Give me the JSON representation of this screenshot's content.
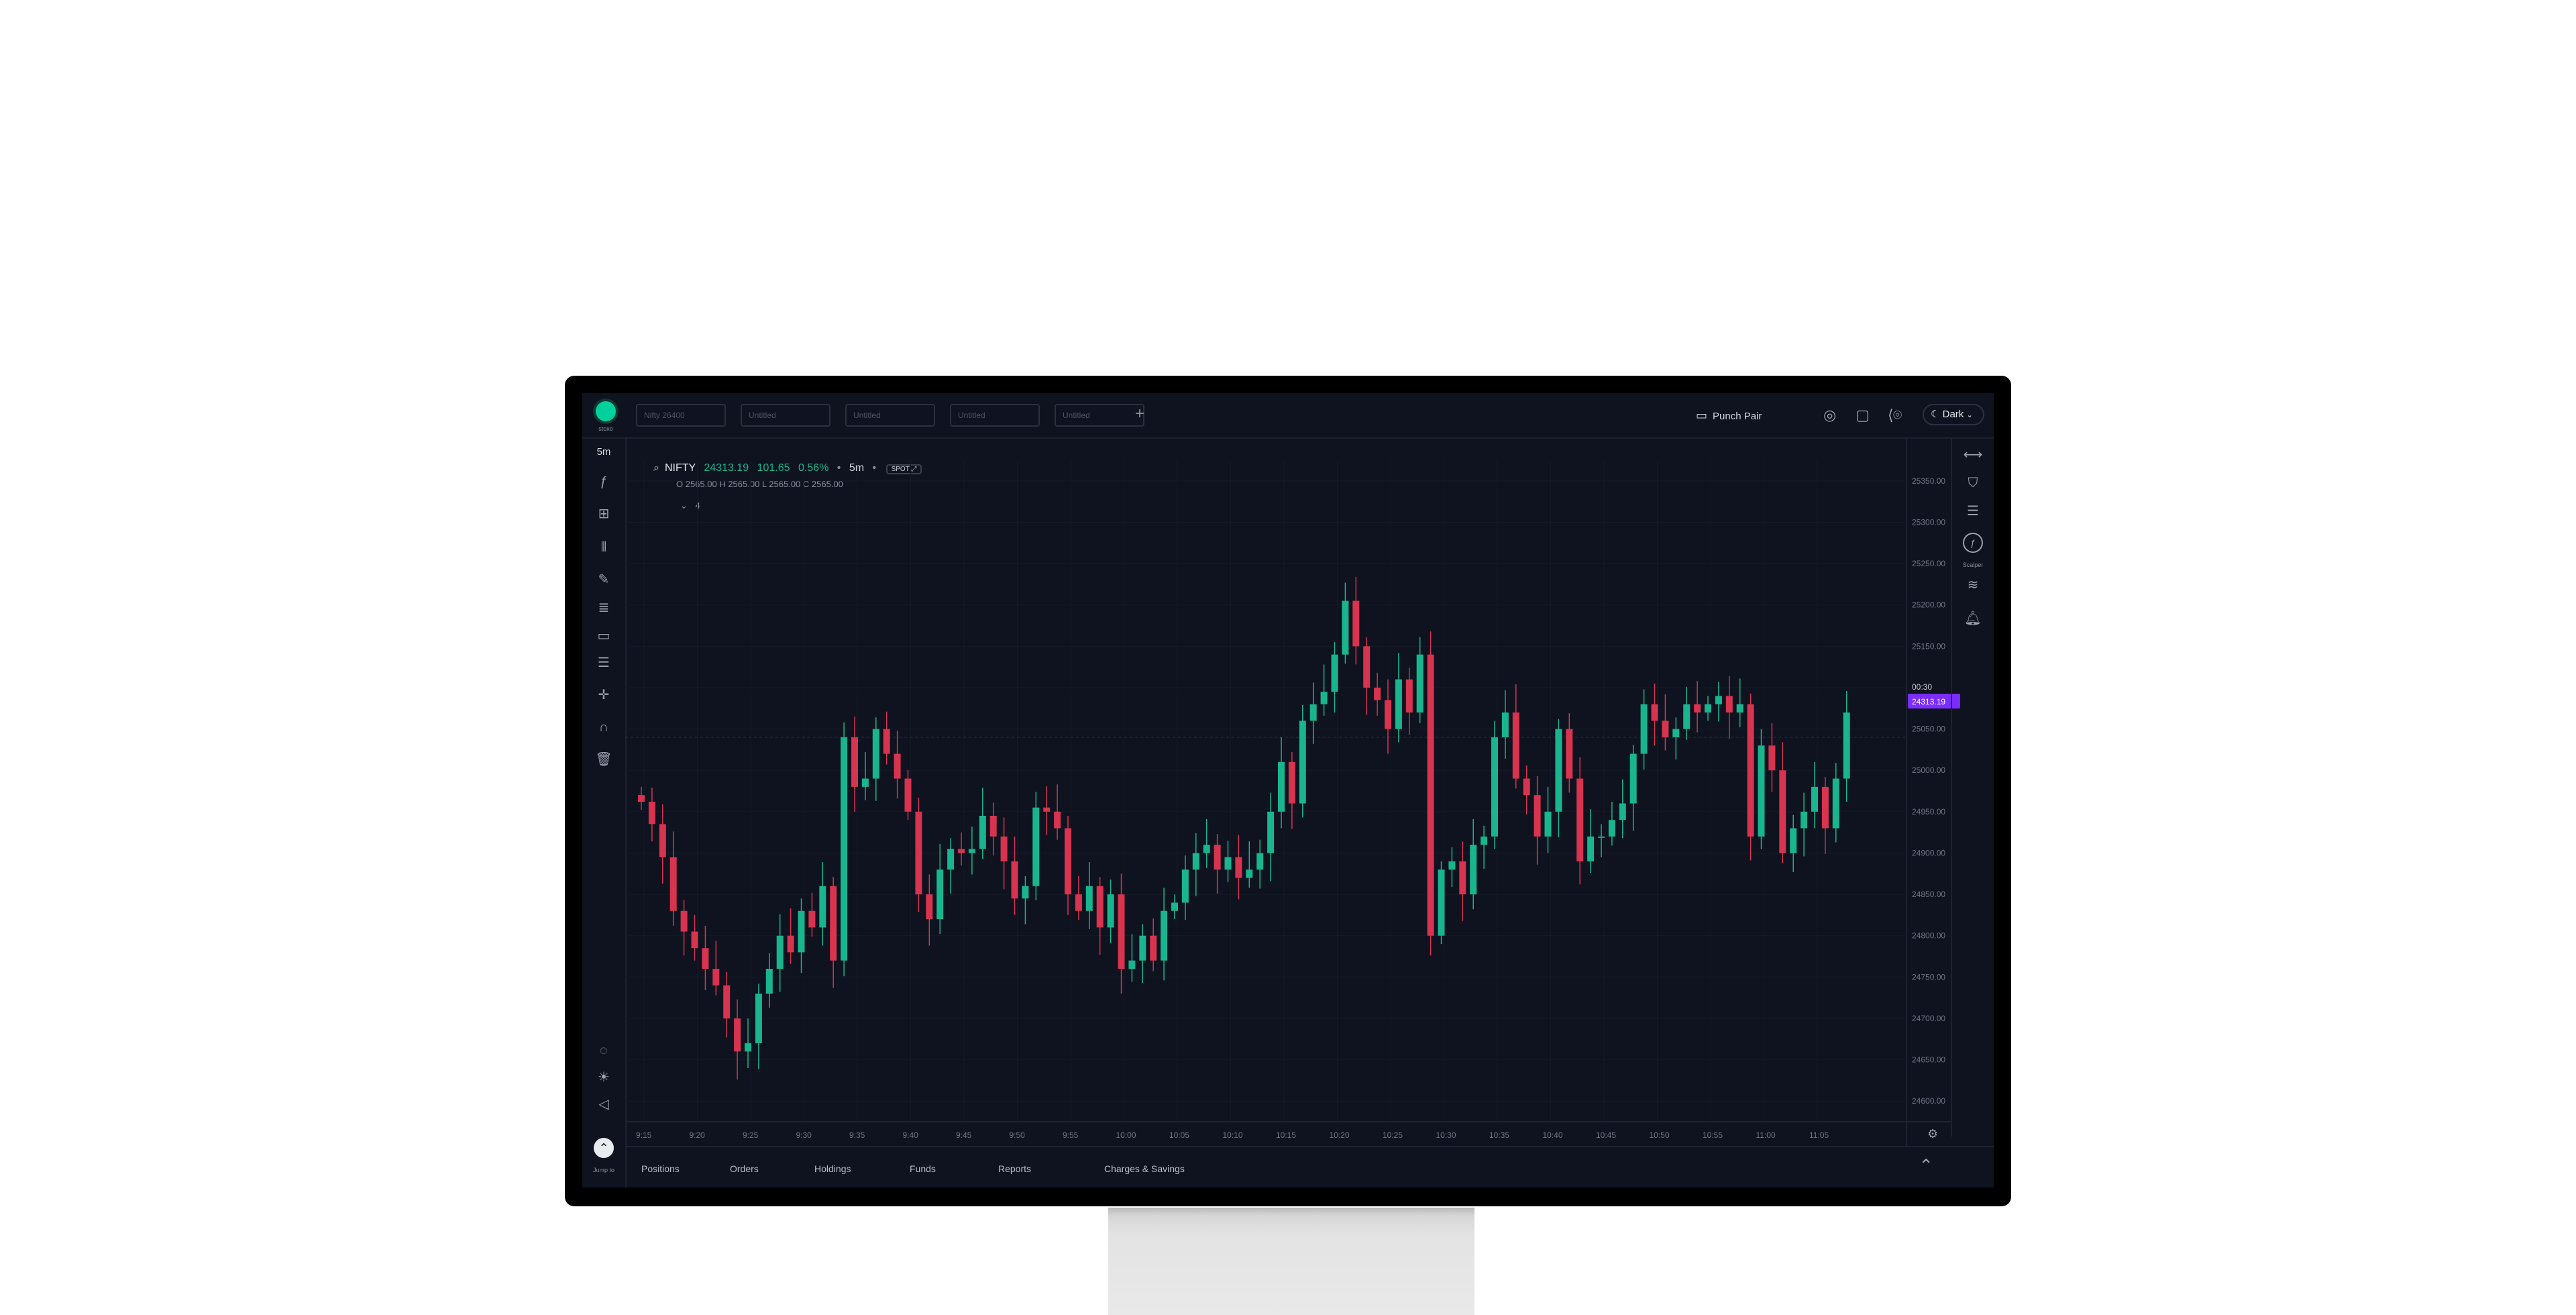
{
  "topbar": {
    "logo_text": "stoxo",
    "chart_tabs": [
      "Nifty 26400",
      "Untitled",
      "Untitled",
      "Untitled",
      "Untitled"
    ],
    "punch_pair_label": "Punch Pair",
    "theme_label": "Dark"
  },
  "leftbar": {
    "interval": "5m",
    "jump_label": "Jump to"
  },
  "legend": {
    "symbol": "NIFTY",
    "price": "24313.19",
    "change": "101.65",
    "change_pct": "0.56%",
    "interval": "5m",
    "spot_label": "SPOT",
    "ohlc": "O 2565.00   H 2565.00   L 2565.00   C 2565.00",
    "indicators_count": "4"
  },
  "rightbar": {
    "scalper_label": "Scalper"
  },
  "bottom_tabs": [
    "Positions",
    "Orders",
    "Holdings",
    "Funds",
    "Reports",
    "Charges & Savings"
  ],
  "colors": {
    "up": "#18b58f",
    "down": "#d8334f",
    "accent": "#00d09c",
    "price_tag": "#7b2cff"
  },
  "chart_data": {
    "type": "candlestick",
    "x_labels": [
      "9:15",
      "9:20",
      "9:25",
      "9:30",
      "9:35",
      "9:40",
      "9:45",
      "9:50",
      "9:55",
      "10:00",
      "10:05",
      "10:10",
      "10:15",
      "10:20",
      "10:25",
      "10:30",
      "10:35",
      "10:40",
      "10:45",
      "10:50",
      "10:55",
      "11:00",
      "11:05"
    ],
    "y_ticks": [
      25350,
      25300,
      25250,
      25200,
      25150,
      25100,
      25050,
      25000,
      24950,
      24900,
      24850,
      24800,
      24750,
      24700,
      24650,
      24600
    ],
    "ylim": [
      24575,
      25375
    ],
    "last_price": "24313.19",
    "countdown": "00:30",
    "closes": [
      24962,
      24935,
      24895,
      24830,
      24805,
      24785,
      24760,
      24740,
      24700,
      24660,
      24670,
      24730,
      24760,
      24800,
      24780,
      24830,
      24810,
      24860,
      24770,
      25040,
      24980,
      24990,
      25050,
      25020,
      24990,
      24950,
      24850,
      24820,
      24880,
      24905,
      24900,
      24905,
      24945,
      24920,
      24890,
      24845,
      24860,
      24955,
      24950,
      24930,
      24850,
      24830,
      24860,
      24810,
      24850,
      24760,
      24770,
      24800,
      24770,
      24830,
      24840,
      24880,
      24900,
      24910,
      24880,
      24895,
      24870,
      24880,
      24900,
      24950,
      25010,
      24960,
      25060,
      25080,
      25095,
      25140,
      25205,
      25150,
      25100,
      25085,
      25050,
      25110,
      25070,
      25140,
      24800,
      24880,
      24890,
      24850,
      24910,
      24920,
      25040,
      25070,
      24990,
      24970,
      24920,
      24950,
      25050,
      24990,
      24890,
      24920,
      24920,
      24940,
      24960,
      25020,
      25080,
      25060,
      25040,
      25050,
      25080,
      25070,
      25080,
      25090,
      25070,
      25080,
      24920,
      25030,
      25000,
      24900,
      24930,
      24950,
      24980,
      24930,
      24990,
      25070
    ]
  }
}
